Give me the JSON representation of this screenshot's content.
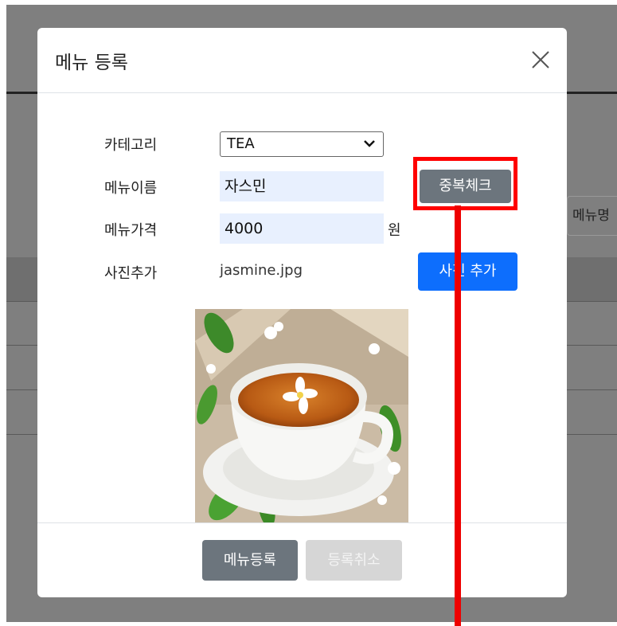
{
  "background": {
    "right_input_label": "메뉴명"
  },
  "modal": {
    "title": "메뉴 등록",
    "close_icon": "close-icon",
    "fields": {
      "category_label": "카테고리",
      "category_value": "TEA",
      "name_label": "메뉴이름",
      "name_value": "자스민",
      "price_label": "메뉴가격",
      "price_value": "4000",
      "price_unit": "원",
      "photo_label": "사진추가",
      "photo_filename": "jasmine.jpg"
    },
    "buttons": {
      "duplicate_check": "중복체크",
      "add_photo": "사진 추가",
      "register": "메뉴등록",
      "cancel": "등록취소"
    }
  },
  "colors": {
    "secondary": "#6c757d",
    "primary": "#0d6efd",
    "annotation": "#ff0000",
    "autofill_bg": "#e8f0fe"
  }
}
